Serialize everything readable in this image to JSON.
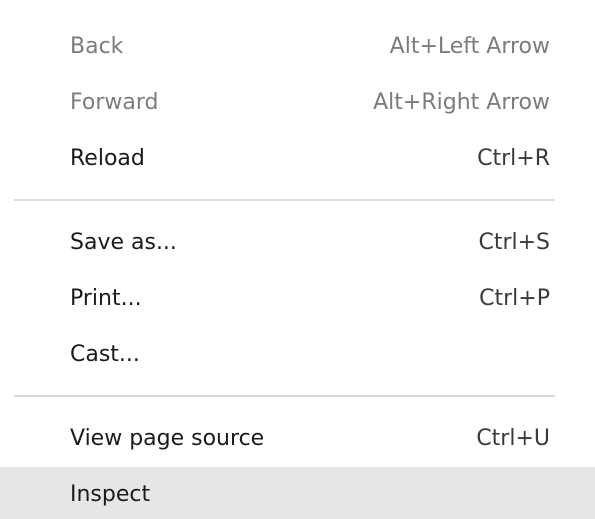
{
  "menu": {
    "items": [
      {
        "label": "Back",
        "shortcut": "Alt+Left Arrow",
        "state": "disabled"
      },
      {
        "label": "Forward",
        "shortcut": "Alt+Right Arrow",
        "state": "disabled"
      },
      {
        "label": "Reload",
        "shortcut": "Ctrl+R",
        "state": "enabled"
      },
      {
        "label": "Save as...",
        "shortcut": "Ctrl+S",
        "state": "enabled"
      },
      {
        "label": "Print...",
        "shortcut": "Ctrl+P",
        "state": "enabled"
      },
      {
        "label": "Cast...",
        "shortcut": "",
        "state": "enabled"
      },
      {
        "label": "View page source",
        "shortcut": "Ctrl+U",
        "state": "enabled"
      },
      {
        "label": "Inspect",
        "shortcut": "",
        "state": "highlighted"
      }
    ]
  },
  "colors": {
    "background": "#ffffff",
    "text": "#1b1b1b",
    "disabled_text": "#7c7c7c",
    "highlight": "#e6e6e6",
    "separator": "#d9d9d9"
  }
}
